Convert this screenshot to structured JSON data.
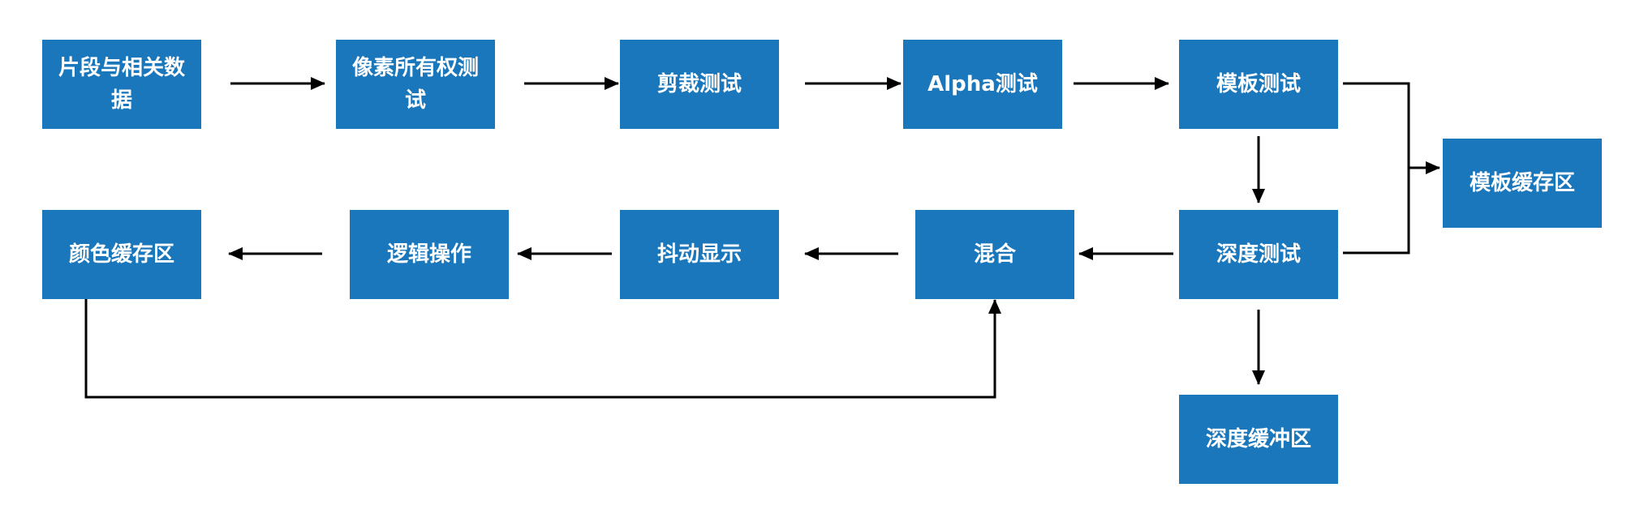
{
  "nodes": {
    "fragment_data": "片段与相关数据",
    "pixel_ownership": "像素所有权测试",
    "scissor_test": "剪裁测试",
    "alpha_test": "Alpha测试",
    "stencil_test": "模板测试",
    "stencil_buffer": "模板缓存区",
    "depth_test": "深度测试",
    "depth_buffer": "深度缓冲区",
    "blending": "混合",
    "dithering": "抖动显示",
    "logic_op": "逻辑操作",
    "color_buffer": "颜色缓存区"
  },
  "colors": {
    "box_fill": "#1a77bb",
    "box_text": "#ffffff",
    "arrow": "#000000"
  }
}
